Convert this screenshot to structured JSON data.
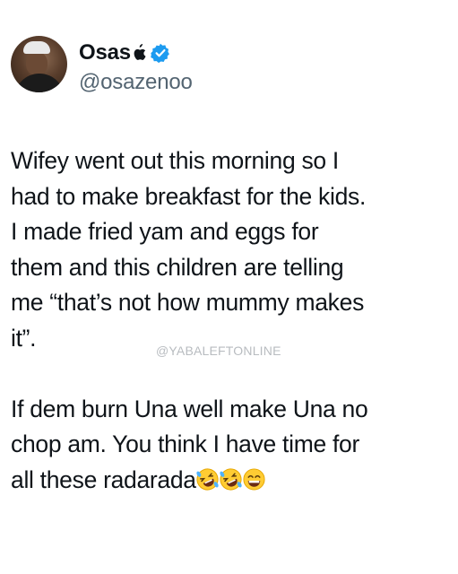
{
  "author": {
    "display_name": "Osas",
    "handle": "@osazenoo",
    "badge_icon": "apple-icon",
    "verified_icon": "verified-badge-icon",
    "verified_color": "#1d9bf0"
  },
  "tweet": {
    "paragraph1": [
      "Wifey went out this morning so I",
      "had to make breakfast for the kids.",
      "I made fried yam and eggs for",
      "them and this children are telling",
      "me “that’s not how mummy makes",
      "it”."
    ],
    "paragraph2": [
      "If dem burn Una well make Una no",
      "chop am. You think I have time for",
      "all these radarada"
    ],
    "emojis": [
      "rolling-on-floor-laughing",
      "rolling-on-floor-laughing",
      "grinning-squinting-face"
    ]
  },
  "watermark": "@YABALEFTONLINE"
}
